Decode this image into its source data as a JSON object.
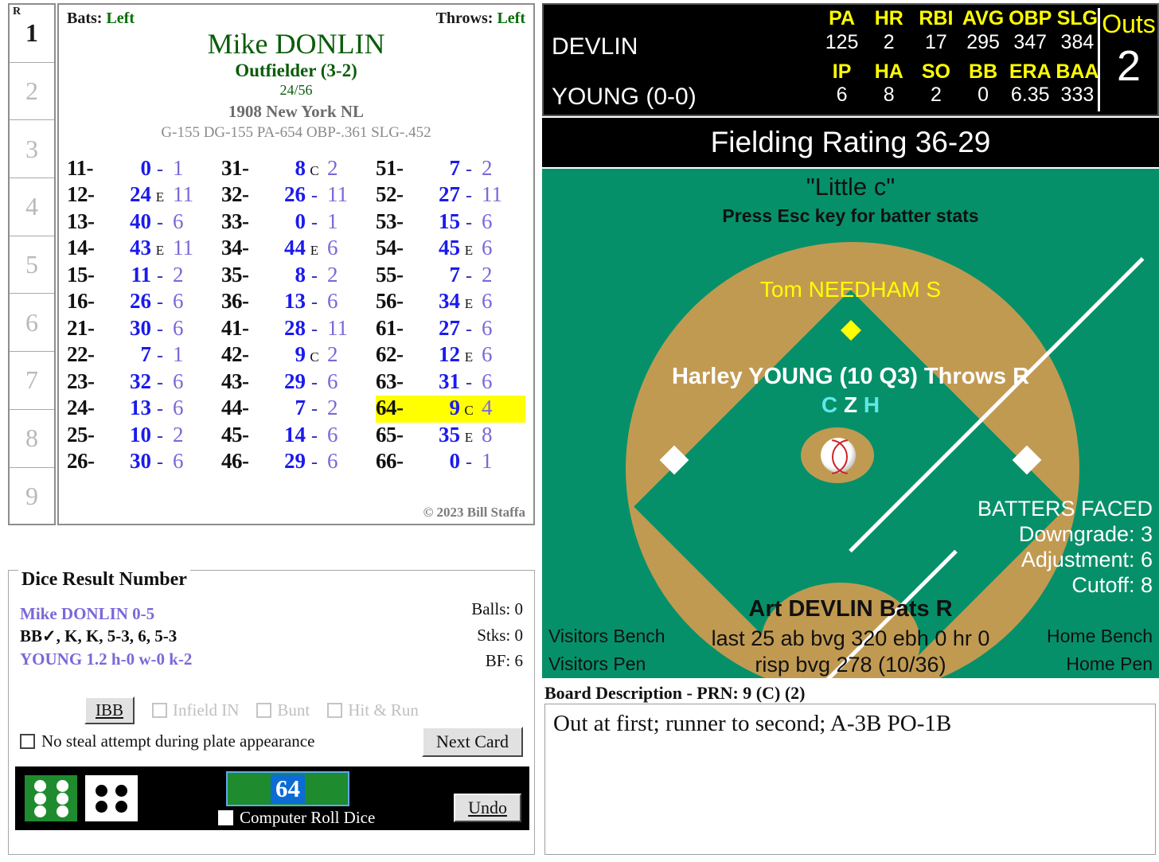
{
  "lineup": {
    "runner_flag": "R",
    "slots": [
      "1",
      "2",
      "3",
      "4",
      "5",
      "6",
      "7",
      "8",
      "9"
    ],
    "active_index": 0
  },
  "player_card": {
    "bats_label": "Bats:",
    "bats_value": "Left",
    "throws_label": "Throws:",
    "throws_value": "Left",
    "name": "Mike DONLIN",
    "position": "Outfielder (3-2)",
    "fraction": "24/56",
    "team": "1908 New York NL",
    "stat_line": "G-155 DG-155 PA-654 OBP-.361 SLG-.452",
    "copyright": "© 2023 Bill Staffa",
    "highlight_code": "64-",
    "columns": [
      [
        {
          "code": "11-",
          "num": "0",
          "flag": "-",
          "tail": "1"
        },
        {
          "code": "12-",
          "num": "24",
          "flag": "E",
          "tail": "11"
        },
        {
          "code": "13-",
          "num": "40",
          "flag": "-",
          "tail": "6"
        },
        {
          "code": "14-",
          "num": "43",
          "flag": "E",
          "tail": "11"
        },
        {
          "code": "15-",
          "num": "11",
          "flag": "-",
          "tail": "2"
        },
        {
          "code": "16-",
          "num": "26",
          "flag": "-",
          "tail": "6"
        },
        {
          "code": "21-",
          "num": "30",
          "flag": "-",
          "tail": "6"
        },
        {
          "code": "22-",
          "num": "7",
          "flag": "-",
          "tail": "1"
        },
        {
          "code": "23-",
          "num": "32",
          "flag": "-",
          "tail": "6"
        },
        {
          "code": "24-",
          "num": "13",
          "flag": "-",
          "tail": "6"
        },
        {
          "code": "25-",
          "num": "10",
          "flag": "-",
          "tail": "2"
        },
        {
          "code": "26-",
          "num": "30",
          "flag": "-",
          "tail": "6"
        }
      ],
      [
        {
          "code": "31-",
          "num": "8",
          "flag": "C",
          "tail": "2"
        },
        {
          "code": "32-",
          "num": "26",
          "flag": "-",
          "tail": "11"
        },
        {
          "code": "33-",
          "num": "0",
          "flag": "-",
          "tail": "1"
        },
        {
          "code": "34-",
          "num": "44",
          "flag": "E",
          "tail": "6"
        },
        {
          "code": "35-",
          "num": "8",
          "flag": "-",
          "tail": "2"
        },
        {
          "code": "36-",
          "num": "13",
          "flag": "-",
          "tail": "6"
        },
        {
          "code": "41-",
          "num": "28",
          "flag": "-",
          "tail": "11"
        },
        {
          "code": "42-",
          "num": "9",
          "flag": "C",
          "tail": "2"
        },
        {
          "code": "43-",
          "num": "29",
          "flag": "-",
          "tail": "6"
        },
        {
          "code": "44-",
          "num": "7",
          "flag": "-",
          "tail": "2"
        },
        {
          "code": "45-",
          "num": "14",
          "flag": "-",
          "tail": "6"
        },
        {
          "code": "46-",
          "num": "29",
          "flag": "-",
          "tail": "6"
        }
      ],
      [
        {
          "code": "51-",
          "num": "7",
          "flag": "-",
          "tail": "2"
        },
        {
          "code": "52-",
          "num": "27",
          "flag": "-",
          "tail": "11"
        },
        {
          "code": "53-",
          "num": "15",
          "flag": "-",
          "tail": "6"
        },
        {
          "code": "54-",
          "num": "45",
          "flag": "E",
          "tail": "6"
        },
        {
          "code": "55-",
          "num": "7",
          "flag": "-",
          "tail": "2"
        },
        {
          "code": "56-",
          "num": "34",
          "flag": "E",
          "tail": "6"
        },
        {
          "code": "61-",
          "num": "27",
          "flag": "-",
          "tail": "6"
        },
        {
          "code": "62-",
          "num": "12",
          "flag": "E",
          "tail": "6"
        },
        {
          "code": "63-",
          "num": "31",
          "flag": "-",
          "tail": "6"
        },
        {
          "code": "64-",
          "num": "9",
          "flag": "C",
          "tail": "4"
        },
        {
          "code": "65-",
          "num": "35",
          "flag": "E",
          "tail": "8"
        },
        {
          "code": "66-",
          "num": "0",
          "flag": "-",
          "tail": "1"
        }
      ]
    ]
  },
  "dice_panel": {
    "title": "Dice Result Number",
    "batter_line": "Mike DONLIN  0-5",
    "results_line": "BB✓, K, K, 5-3, 6, 5-3",
    "pitcher_line": "YOUNG  1.2  h-0  w-0  k-2",
    "balls": "Balls: 0",
    "strikes": "Stks: 0",
    "bf": "BF: 6",
    "ibb_label": "IBB",
    "infield_in_label": "Infield IN",
    "bunt_label": "Bunt",
    "hit_and_run_label": "Hit & Run",
    "no_steal_label": "No steal attempt during plate appearance",
    "next_card_label": "Next Card",
    "undo_label": "Undo",
    "computer_roll_label": "Computer Roll Dice",
    "dice_value": "64",
    "die1_pips": 6,
    "die2_pips": 4,
    "die1_color": "#1e8c2e",
    "die2_color": "#ffffff"
  },
  "scoreboard": {
    "batter_name": "DEVLIN",
    "pitcher_name": "YOUNG (0-0)",
    "batter_headers": [
      "PA",
      "HR",
      "RBI",
      "AVG",
      "OBP",
      "SLG"
    ],
    "batter_values": [
      "125",
      "2",
      "17",
      "295",
      "347",
      "384"
    ],
    "pitcher_headers": [
      "IP",
      "HA",
      "SO",
      "BB",
      "ERA",
      "BAA"
    ],
    "pitcher_values": [
      "6",
      "8",
      "2",
      "0",
      "6.35",
      "333"
    ],
    "outs_label": "Outs",
    "outs_value": "2",
    "header_color": "#ffff00"
  },
  "field": {
    "rating": "Fielding Rating 36-29",
    "park_name": "\"Little c\"",
    "esc_hint": "Press Esc key for batter stats",
    "catcher": "Tom NEEDHAM  S",
    "pitcher": "Harley YOUNG (10 Q3) Throws R",
    "pitcher_grades": "C Z H",
    "batters_faced_title": "BATTERS FACED",
    "downgrade": "Downgrade: 3",
    "adjustment": "Adjustment: 6",
    "cutoff": "Cutoff: 8",
    "batter": "Art DEVLIN Bats R",
    "batter_last25": "last 25 ab bvg 320 ebh 0 hr 0",
    "batter_risp": "risp bvg 278 (10/36)",
    "visitors_bench": "Visitors Bench",
    "visitors_pen": "Visitors Pen",
    "home_bench": "Home Bench",
    "home_pen": "Home Pen",
    "grass_color": "#069069",
    "dirt_color": "#c19a52"
  },
  "board_description": {
    "label": "Board Description - PRN: 9 (C) (2)",
    "text": "Out at first; runner to second; A-3B PO-1B"
  }
}
